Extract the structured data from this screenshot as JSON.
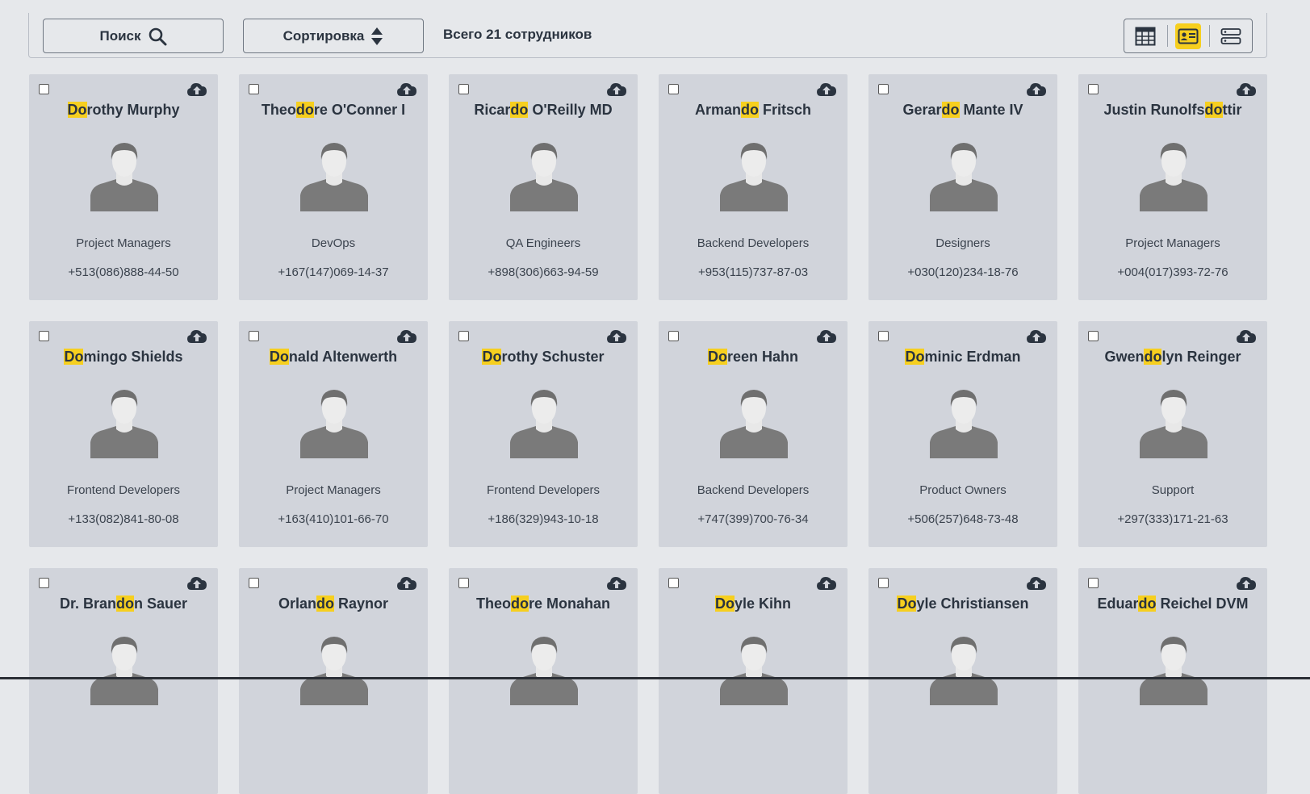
{
  "toolbar": {
    "search_label": "Поиск",
    "search_icon": "search-icon",
    "sort_label": "Сортировка",
    "sort_icon": "sort-updown-icon",
    "total_text": "Всего 21 сотрудников",
    "views": [
      {
        "name": "table-view",
        "icon": "table-icon",
        "active": false
      },
      {
        "name": "cards-view",
        "icon": "id-card-icon",
        "active": true
      },
      {
        "name": "list-view",
        "icon": "list-rows-icon",
        "active": false
      }
    ]
  },
  "search_highlight": "do",
  "colors": {
    "highlight": "#f6cf1f",
    "card_bg": "#d1d4db",
    "page_bg": "#e6e8eb"
  },
  "employees": [
    {
      "name": "Dorothy Murphy",
      "department": "Project Managers",
      "phone": "+513(086)888-44-50"
    },
    {
      "name": "Theodore O'Conner I",
      "department": "DevOps",
      "phone": "+167(147)069-14-37"
    },
    {
      "name": "Ricardo O'Reilly MD",
      "department": "QA Engineers",
      "phone": "+898(306)663-94-59"
    },
    {
      "name": "Armando Fritsch",
      "department": "Backend Developers",
      "phone": "+953(115)737-87-03"
    },
    {
      "name": "Gerardo Mante IV",
      "department": "Designers",
      "phone": "+030(120)234-18-76"
    },
    {
      "name": "Justin Runolfsdottir",
      "department": "Project Managers",
      "phone": "+004(017)393-72-76"
    },
    {
      "name": "Domingo Shields",
      "department": "Frontend Developers",
      "phone": "+133(082)841-80-08"
    },
    {
      "name": "Donald Altenwerth",
      "department": "Project Managers",
      "phone": "+163(410)101-66-70"
    },
    {
      "name": "Dorothy Schuster",
      "department": "Frontend Developers",
      "phone": "+186(329)943-10-18"
    },
    {
      "name": "Doreen Hahn",
      "department": "Backend Developers",
      "phone": "+747(399)700-76-34"
    },
    {
      "name": "Dominic Erdman",
      "department": "Product Owners",
      "phone": "+506(257)648-73-48"
    },
    {
      "name": "Gwendolyn Reinger",
      "department": "Support",
      "phone": "+297(333)171-21-63"
    },
    {
      "name": "Dr. Brandon Sauer",
      "department": "",
      "phone": ""
    },
    {
      "name": "Orlando Raynor",
      "department": "",
      "phone": ""
    },
    {
      "name": "Theodore Monahan",
      "department": "",
      "phone": ""
    },
    {
      "name": "Doyle Kihn",
      "department": "",
      "phone": ""
    },
    {
      "name": "Doyle Christiansen",
      "department": "",
      "phone": ""
    },
    {
      "name": "Eduardo Reichel DVM",
      "department": "",
      "phone": ""
    }
  ]
}
